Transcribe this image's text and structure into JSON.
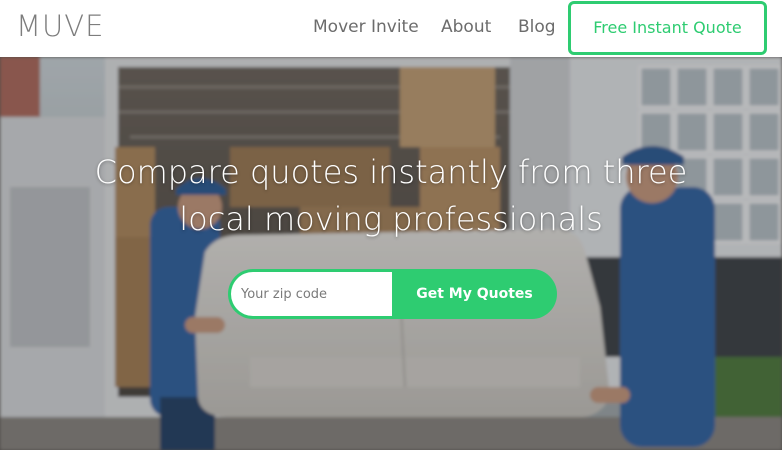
{
  "nav": {
    "logo": "MUVE",
    "links": [
      {
        "label": "Mover Invite"
      },
      {
        "label": "About"
      },
      {
        "label": "Blog"
      }
    ],
    "cta_label": "Free Instant Quote"
  },
  "hero": {
    "headline_line1": "Compare quotes instantly from three",
    "headline_line2": "local moving professionals",
    "zip_placeholder": "Your zip code",
    "zip_value": "",
    "submit_label": "Get My Quotes",
    "background_image": "two movers in blue uniforms carrying a white sofa out of a moving van full of cardboard boxes"
  },
  "colors": {
    "accent": "#2ecc71",
    "nav_text": "#6c6c6c",
    "logo_text": "#7d7d7d",
    "hero_text": "#ffffff"
  }
}
